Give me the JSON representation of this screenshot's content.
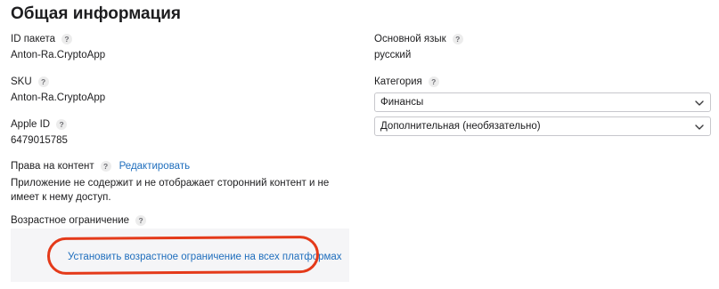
{
  "section_title": "Общая информация",
  "left": {
    "bundle_id": {
      "label": "ID пакета",
      "value": "Anton-Ra.CryptoApp"
    },
    "sku": {
      "label": "SKU",
      "value": "Anton-Ra.CryptoApp"
    },
    "apple_id": {
      "label": "Apple ID",
      "value": "6479015785"
    },
    "content_rights": {
      "label": "Права на контент",
      "edit_link": "Редактировать",
      "description": "Приложение не содержит и не отображает сторонний контент и не имеет к нему доступ."
    },
    "age_rating": {
      "label": "Возрастное ограничение",
      "set_link": "Установить возрастное ограничение на всех платформах"
    }
  },
  "right": {
    "primary_language": {
      "label": "Основной язык",
      "value": "русский"
    },
    "category": {
      "label": "Категория",
      "primary": "Финансы",
      "secondary": "Дополнительная (необязательно)"
    }
  },
  "help_glyph": "?",
  "colors": {
    "link": "#1f6ebd",
    "highlight": "#e43a1a"
  }
}
